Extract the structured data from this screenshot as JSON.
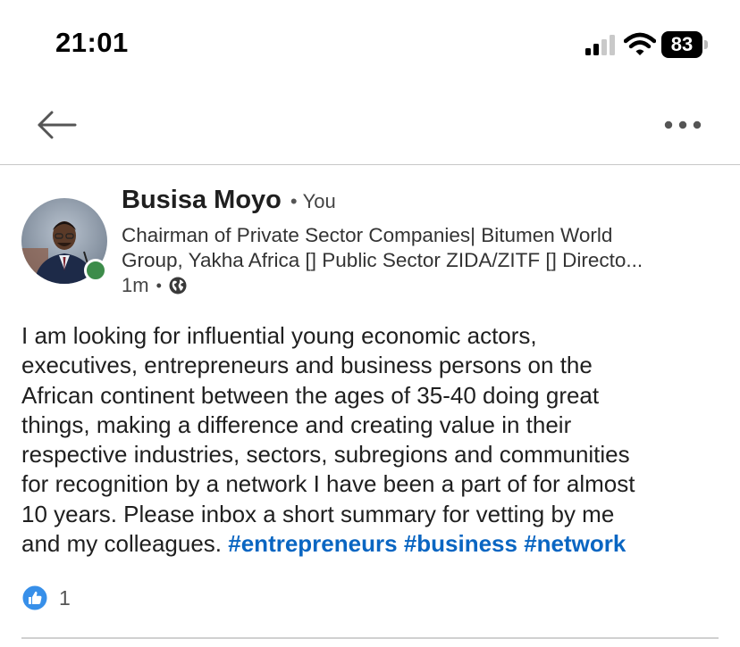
{
  "status_bar": {
    "time": "21:01",
    "battery": "83"
  },
  "nav": {
    "back_icon": "arrow-left-icon",
    "more_icon": "more-horizontal-icon"
  },
  "post": {
    "author": {
      "name": "Busisa Moyo",
      "separator": "•",
      "relation": "You",
      "headline_lines": [
        "Chairman of Private Sector Companies| Bitumen World",
        "Group, Yakha Africa [] Public Sector ZIDA/ZITF [] Directo..."
      ],
      "time_ago": "1m",
      "meta_separator": "•",
      "visibility_icon": "globe-icon",
      "online_status_color": "#3d8c4a"
    },
    "body_lines": [
      "I am looking for influential young economic actors,",
      "executives, entrepreneurs and business persons on the",
      "African continent between the ages of 35-40 doing great",
      "things, making a difference and creating value in their",
      "respective industries, sectors, subregions and communities",
      "for recognition by a network I have been a part of for almost",
      "10 years. Please inbox a short summary for vetting by me"
    ],
    "body_last_line_text": "and my colleagues.",
    "hashtags": [
      "#entrepreneurs",
      "#business",
      "#network"
    ],
    "reactions": {
      "icon": "like-icon",
      "count": "1"
    }
  },
  "colors": {
    "hashtag": "#0a66c2",
    "like": "#378fe9"
  }
}
